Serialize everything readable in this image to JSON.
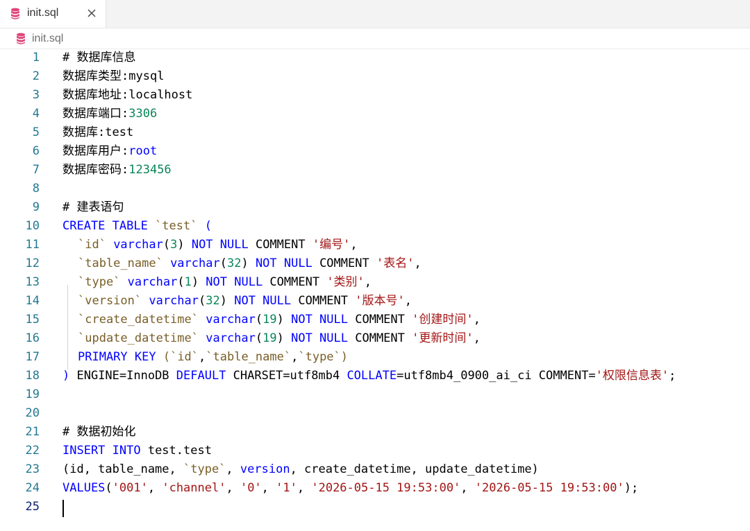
{
  "tab": {
    "title": "init.sql"
  },
  "breadcrumb": {
    "file": "init.sql"
  },
  "editor": {
    "active_line": 25,
    "lines": [
      {
        "n": "1",
        "indent": false,
        "tokens": [
          {
            "t": "# 数据库信息",
            "c": "comment"
          }
        ]
      },
      {
        "n": "2",
        "indent": false,
        "tokens": [
          {
            "t": "数据库类型:",
            "c": "plain"
          },
          {
            "t": "mysql",
            "c": "plain"
          }
        ]
      },
      {
        "n": "3",
        "indent": false,
        "tokens": [
          {
            "t": "数据库地址:",
            "c": "plain"
          },
          {
            "t": "localhost",
            "c": "plain"
          }
        ]
      },
      {
        "n": "4",
        "indent": false,
        "tokens": [
          {
            "t": "数据库端口:",
            "c": "plain"
          },
          {
            "t": "3306",
            "c": "num"
          }
        ]
      },
      {
        "n": "5",
        "indent": false,
        "tokens": [
          {
            "t": "数据库:",
            "c": "plain"
          },
          {
            "t": "test",
            "c": "plain"
          }
        ]
      },
      {
        "n": "6",
        "indent": false,
        "tokens": [
          {
            "t": "数据库用户:",
            "c": "plain"
          },
          {
            "t": "root",
            "c": "kw"
          }
        ]
      },
      {
        "n": "7",
        "indent": false,
        "tokens": [
          {
            "t": "数据库密码:",
            "c": "plain"
          },
          {
            "t": "123456",
            "c": "num"
          }
        ]
      },
      {
        "n": "8",
        "indent": false,
        "tokens": []
      },
      {
        "n": "9",
        "indent": false,
        "tokens": [
          {
            "t": "# 建表语句",
            "c": "comment"
          }
        ]
      },
      {
        "n": "10",
        "indent": false,
        "tokens": [
          {
            "t": "CREATE TABLE ",
            "c": "kw"
          },
          {
            "t": "`test`",
            "c": "ident"
          },
          {
            "t": " (",
            "c": "kw"
          }
        ]
      },
      {
        "n": "11",
        "indent": true,
        "tokens": [
          {
            "t": "`id`",
            "c": "ident"
          },
          {
            "t": " varchar",
            "c": "kw"
          },
          {
            "t": "(",
            "c": "plain"
          },
          {
            "t": "3",
            "c": "num"
          },
          {
            "t": ") ",
            "c": "plain"
          },
          {
            "t": "NOT NULL",
            "c": "kw"
          },
          {
            "t": " COMMENT ",
            "c": "plain"
          },
          {
            "t": "'编号'",
            "c": "str"
          },
          {
            "t": ",",
            "c": "plain"
          }
        ]
      },
      {
        "n": "12",
        "indent": true,
        "tokens": [
          {
            "t": "`table_name`",
            "c": "ident"
          },
          {
            "t": " varchar",
            "c": "kw"
          },
          {
            "t": "(",
            "c": "plain"
          },
          {
            "t": "32",
            "c": "num"
          },
          {
            "t": ") ",
            "c": "plain"
          },
          {
            "t": "NOT NULL",
            "c": "kw"
          },
          {
            "t": " COMMENT ",
            "c": "plain"
          },
          {
            "t": "'表名'",
            "c": "str"
          },
          {
            "t": ",",
            "c": "plain"
          }
        ]
      },
      {
        "n": "13",
        "indent": true,
        "tokens": [
          {
            "t": "`type`",
            "c": "ident"
          },
          {
            "t": " varchar",
            "c": "kw"
          },
          {
            "t": "(",
            "c": "plain"
          },
          {
            "t": "1",
            "c": "num"
          },
          {
            "t": ") ",
            "c": "plain"
          },
          {
            "t": "NOT NULL",
            "c": "kw"
          },
          {
            "t": " COMMENT ",
            "c": "plain"
          },
          {
            "t": "'类别'",
            "c": "str"
          },
          {
            "t": ",",
            "c": "plain"
          }
        ]
      },
      {
        "n": "14",
        "indent": true,
        "tokens": [
          {
            "t": "`version`",
            "c": "ident"
          },
          {
            "t": " varchar",
            "c": "kw"
          },
          {
            "t": "(",
            "c": "plain"
          },
          {
            "t": "32",
            "c": "num"
          },
          {
            "t": ") ",
            "c": "plain"
          },
          {
            "t": "NOT NULL",
            "c": "kw"
          },
          {
            "t": " COMMENT ",
            "c": "plain"
          },
          {
            "t": "'版本号'",
            "c": "str"
          },
          {
            "t": ",",
            "c": "plain"
          }
        ]
      },
      {
        "n": "15",
        "indent": true,
        "tokens": [
          {
            "t": "`create_datetime`",
            "c": "ident"
          },
          {
            "t": " varchar",
            "c": "kw"
          },
          {
            "t": "(",
            "c": "plain"
          },
          {
            "t": "19",
            "c": "num"
          },
          {
            "t": ") ",
            "c": "plain"
          },
          {
            "t": "NOT NULL",
            "c": "kw"
          },
          {
            "t": " COMMENT ",
            "c": "plain"
          },
          {
            "t": "'创建时间'",
            "c": "str"
          },
          {
            "t": ",",
            "c": "plain"
          }
        ]
      },
      {
        "n": "16",
        "indent": true,
        "tokens": [
          {
            "t": "`update_datetime`",
            "c": "ident"
          },
          {
            "t": " varchar",
            "c": "kw"
          },
          {
            "t": "(",
            "c": "plain"
          },
          {
            "t": "19",
            "c": "num"
          },
          {
            "t": ") ",
            "c": "plain"
          },
          {
            "t": "NOT NULL",
            "c": "kw"
          },
          {
            "t": " COMMENT ",
            "c": "plain"
          },
          {
            "t": "'更新时间'",
            "c": "str"
          },
          {
            "t": ",",
            "c": "plain"
          }
        ]
      },
      {
        "n": "17",
        "indent": true,
        "tokens": [
          {
            "t": "PRIMARY KEY ",
            "c": "kw"
          },
          {
            "t": "(",
            "c": "ident"
          },
          {
            "t": "`id`",
            "c": "ident"
          },
          {
            "t": ",",
            "c": "plain"
          },
          {
            "t": "`table_name`",
            "c": "ident"
          },
          {
            "t": ",",
            "c": "plain"
          },
          {
            "t": "`type`",
            "c": "ident"
          },
          {
            "t": ")",
            "c": "ident"
          }
        ]
      },
      {
        "n": "18",
        "indent": false,
        "tokens": [
          {
            "t": ")",
            "c": "kw"
          },
          {
            "t": " ENGINE=InnoDB ",
            "c": "plain"
          },
          {
            "t": "DEFAULT",
            "c": "kw"
          },
          {
            "t": " CHARSET=utf8mb4 ",
            "c": "plain"
          },
          {
            "t": "COLLATE",
            "c": "kw"
          },
          {
            "t": "=utf8mb4_0900_ai_ci COMMENT=",
            "c": "plain"
          },
          {
            "t": "'权限信息表'",
            "c": "str"
          },
          {
            "t": ";",
            "c": "plain"
          }
        ]
      },
      {
        "n": "19",
        "indent": false,
        "tokens": []
      },
      {
        "n": "20",
        "indent": false,
        "tokens": []
      },
      {
        "n": "21",
        "indent": false,
        "tokens": [
          {
            "t": "# 数据初始化",
            "c": "comment"
          }
        ]
      },
      {
        "n": "22",
        "indent": false,
        "tokens": [
          {
            "t": "INSERT INTO",
            "c": "kw"
          },
          {
            "t": " test.test",
            "c": "plain"
          }
        ]
      },
      {
        "n": "23",
        "indent": false,
        "tokens": [
          {
            "t": "(id, table_name, ",
            "c": "plain"
          },
          {
            "t": "`type`",
            "c": "ident"
          },
          {
            "t": ", ",
            "c": "plain"
          },
          {
            "t": "version",
            "c": "kw"
          },
          {
            "t": ", create_datetime, update_datetime)",
            "c": "plain"
          }
        ]
      },
      {
        "n": "24",
        "indent": false,
        "tokens": [
          {
            "t": "VALUES",
            "c": "kw"
          },
          {
            "t": "(",
            "c": "plain"
          },
          {
            "t": "'001'",
            "c": "str"
          },
          {
            "t": ", ",
            "c": "plain"
          },
          {
            "t": "'channel'",
            "c": "str"
          },
          {
            "t": ", ",
            "c": "plain"
          },
          {
            "t": "'0'",
            "c": "str"
          },
          {
            "t": ", ",
            "c": "plain"
          },
          {
            "t": "'1'",
            "c": "str"
          },
          {
            "t": ", ",
            "c": "plain"
          },
          {
            "t": "'2026-05-15 19:53:00'",
            "c": "str"
          },
          {
            "t": ", ",
            "c": "plain"
          },
          {
            "t": "'2026-05-15 19:53:00'",
            "c": "str"
          },
          {
            "t": ");",
            "c": "plain"
          }
        ]
      },
      {
        "n": "25",
        "indent": false,
        "tokens": []
      }
    ]
  },
  "colors": {
    "keyword": "#0000ff",
    "number": "#098658",
    "string": "#a31515",
    "identifier": "#795e26",
    "line_number": "#237893",
    "file_icon": "#e0457b"
  }
}
